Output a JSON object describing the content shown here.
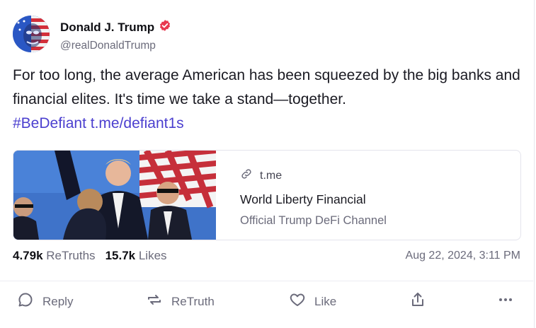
{
  "author": {
    "display_name": "Donald J. Trump",
    "handle": "@realDonaldTrump",
    "verified_icon": "verified-badge-icon",
    "brand_color": "#e8384f"
  },
  "post": {
    "text": "For too long, the average American has been squeezed by the big banks and financial elites. It's time we take a stand—together.",
    "hashtag": "#BeDefiant",
    "link": "t.me/defiant1s",
    "link_color": "#4b3fcf"
  },
  "link_card": {
    "domain": "t.me",
    "title": "World Liberty Financial",
    "description": "Official Trump DeFi Channel"
  },
  "stats": {
    "retruths_count": "4.79k",
    "retruths_label": "ReTruths",
    "likes_count": "15.7k",
    "likes_label": "Likes"
  },
  "timestamp": "Aug 22, 2024, 3:11 PM",
  "actions": {
    "reply": "Reply",
    "retruth": "ReTruth",
    "like": "Like"
  }
}
